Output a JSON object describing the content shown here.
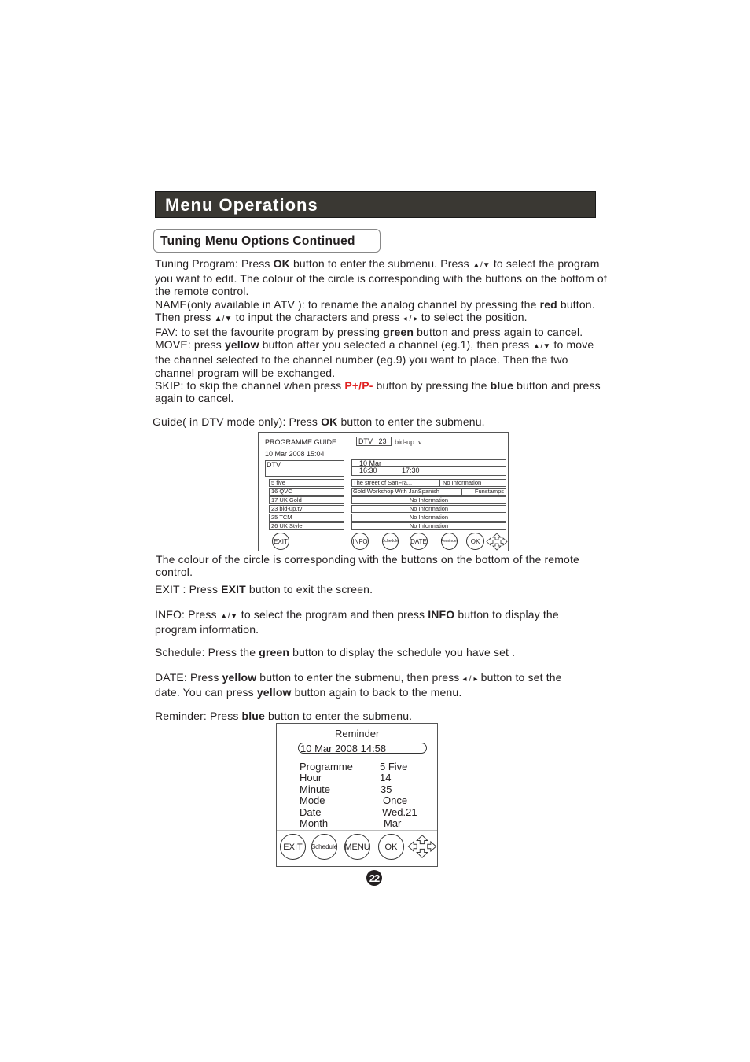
{
  "header": {
    "title": "Menu Operations"
  },
  "section": {
    "title": "Tuning Menu Options Continued"
  },
  "tuning": {
    "p1_a": "Tuning Program: Press ",
    "p1_ok": "OK",
    "p1_b": " button to enter the submenu. Press ",
    "p1_c": " to select the program you want to edit. The colour of the circle is corresponding with the buttons on the bottom of the remote control.",
    "name_a": "NAME(only available in ATV ): to rename the analog channel by pressing the ",
    "name_red": "red",
    "name_b": " button. Then press ",
    "name_c": " to input the characters and press ",
    "name_d": " to select the position.",
    "fav_a": "FAV: to set the favourite program by pressing ",
    "fav_green": "green",
    "fav_b": " button and press again to cancel.",
    "move_a": "MOVE: press ",
    "move_yellow": "yellow",
    "move_b": " button after you selected a channel (eg.1), then press ",
    "move_c": " to move the channel selected to the channel number (eg.9) you want to place. Then the two channel program will be exchanged.",
    "skip_a": "SKIP: to skip the channel when press ",
    "skip_pp": "P+/P-",
    "skip_b": " button by pressing the ",
    "skip_blue": "blue",
    "skip_c": " button and press again to cancel.",
    "guide_a": "Guide( in DTV mode only): Press ",
    "guide_ok": "OK",
    "guide_b": " button to enter the submenu."
  },
  "symbols": {
    "up_down": "▲/▼",
    "left_right": "◂ / ▸"
  },
  "programme_guide": {
    "title": "PROGRAMME GUIDE",
    "channel_box": "DTV   23",
    "channel_name": "bid-up.tv",
    "datetime": "10 Mar 2008 15:04",
    "source": "DTV",
    "date": "10 Mar",
    "times": [
      "16:30",
      "17:30"
    ],
    "channels": [
      "5 five",
      "16 QVC",
      "17 UK Gold",
      "23 bid-up.tv",
      "25 TCM",
      "26 UK Style"
    ],
    "rows": [
      [
        "The street of SanFra...",
        "No Information"
      ],
      [
        "Gold Workshop With JanSpanish",
        "Funstamps"
      ],
      [
        "No Information"
      ],
      [
        "No Information"
      ],
      [
        "No Information"
      ],
      [
        "No Information"
      ]
    ],
    "buttons": [
      "EXIT",
      "INFO",
      "Schedule",
      "DATE",
      "Reminder",
      "OK"
    ]
  },
  "notes": {
    "colour": "The colour of the circle is corresponding with the buttons on the bottom of the remote control.",
    "exit_a": "EXIT : Press ",
    "exit_b": "EXIT",
    "exit_c": " button to exit the screen.",
    "info_a": "INFO: Press ",
    "info_b": " to select the program and then press ",
    "info_c": "INFO",
    "info_d": " button to display the program information.",
    "sched_a": "Schedule: Press the ",
    "sched_b": "green",
    "sched_c": " button to display the schedule you have set .",
    "date_a": "DATE: Press ",
    "date_b": "yellow",
    "date_c": " button to enter the submenu, then press ",
    "date_d": " button to set the date. You can press ",
    "date_e": "yellow",
    "date_f": " button again to back to the menu.",
    "rem_a": "Reminder: Press ",
    "rem_b": "blue",
    "rem_c": " button to enter the submenu."
  },
  "reminder": {
    "title": "Reminder",
    "datetime": "10 Mar 2008 14:58",
    "fields": [
      {
        "label": "Programme",
        "value": "5 Five"
      },
      {
        "label": "Hour",
        "value": "14"
      },
      {
        "label": "Minute",
        "value": "35"
      },
      {
        "label": "Mode",
        "value": "Once"
      },
      {
        "label": "Date",
        "value": "Wed.21"
      },
      {
        "label": "Month",
        "value": "Mar"
      }
    ],
    "buttons": [
      "EXIT",
      "Schedule",
      "MENU",
      "OK"
    ]
  },
  "page_number": "22"
}
